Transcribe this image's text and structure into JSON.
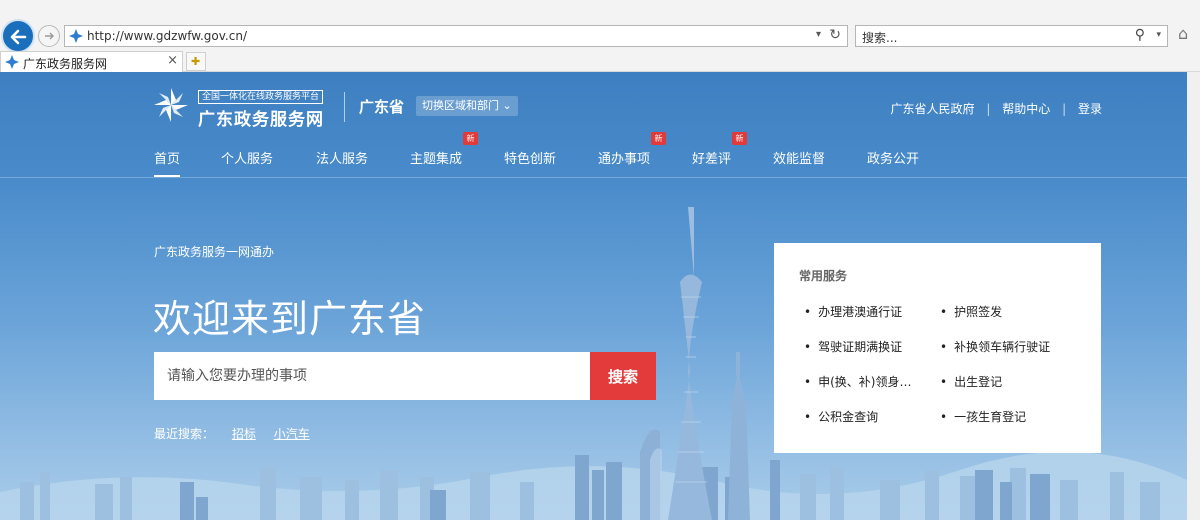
{
  "browser": {
    "url": "http://www.gdzwfw.gov.cn/",
    "search_placeholder": "搜索...",
    "tab_title": "广东政务服务网",
    "tab_close": "×"
  },
  "header": {
    "logo_subtitle": "全国一体化在线政务服务平台",
    "logo_title": "广东政务服务网",
    "province": "广东省",
    "switch_region": "切换区域和部门",
    "links": [
      "广东省人民政府",
      "帮助中心",
      "登录"
    ],
    "link_separator": "|"
  },
  "nav": {
    "items": [
      {
        "label": "首页",
        "active": true
      },
      {
        "label": "个人服务"
      },
      {
        "label": "法人服务"
      },
      {
        "label": "主题集成",
        "badge": "新"
      },
      {
        "label": "特色创新"
      },
      {
        "label": "通办事项",
        "badge": "新"
      },
      {
        "label": "好差评",
        "badge": "新"
      },
      {
        "label": "效能监督"
      },
      {
        "label": "政务公开"
      }
    ]
  },
  "hero": {
    "tagline": "广东政务服务一网通办",
    "welcome": "欢迎来到广东省",
    "search_placeholder": "请输入您要办理的事项",
    "search_button": "搜索",
    "recent_label": "最近搜索：",
    "recent_items": [
      "招标",
      "小汽车"
    ]
  },
  "services": {
    "title": "常用服务",
    "items": [
      "办理港澳通行证",
      "护照签发",
      "驾驶证期满换证",
      "补换领车辆行驶证",
      "申(换、补)领身…",
      "出生登记",
      "公积金查询",
      "一孩生育登记"
    ]
  },
  "colors": {
    "brand_blue": "#3d7fc0",
    "accent_red": "#e33b3b",
    "badge_red": "#e23a3a"
  }
}
